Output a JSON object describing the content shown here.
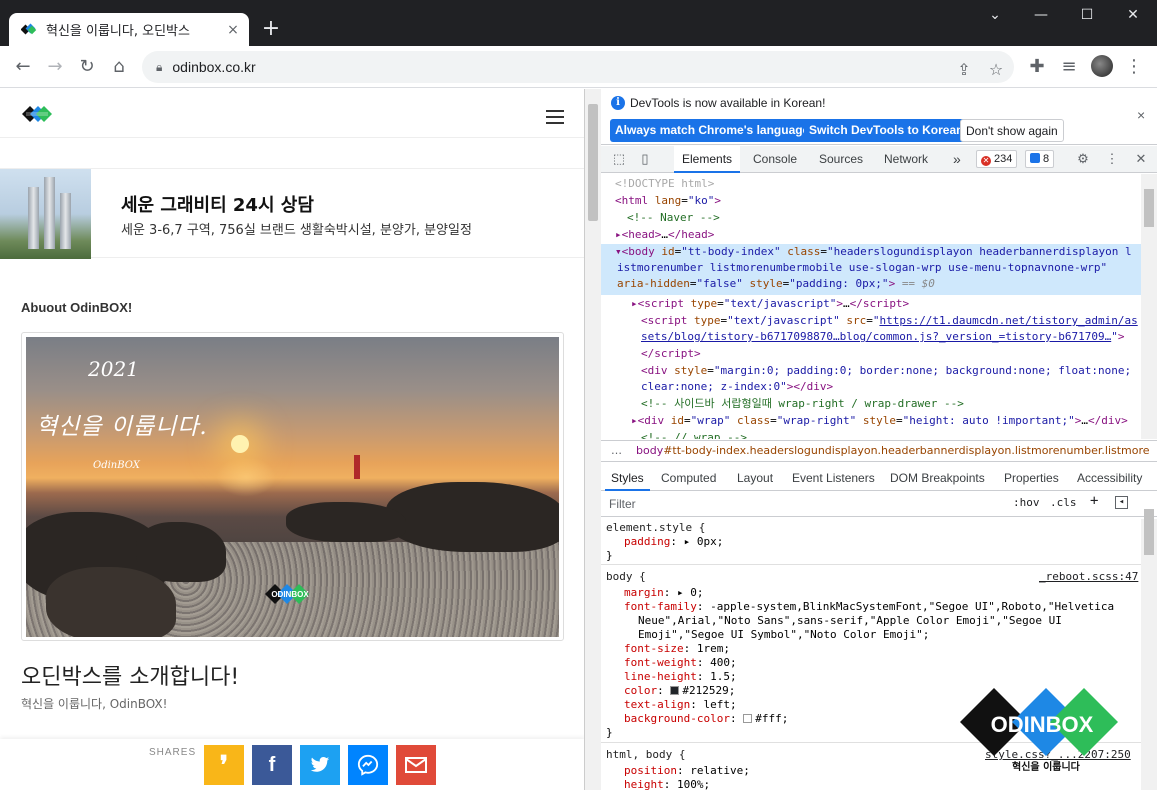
{
  "browser": {
    "tab_title": "혁신을 이룹니다, 오딘박스",
    "tab_close": "×",
    "new_tab": "+",
    "url": "odinbox.co.kr",
    "window_controls": [
      "⌄",
      "—",
      "☐",
      "✕"
    ]
  },
  "page": {
    "banner": {
      "title": "세운 그래비티 24시 상담",
      "subtitle": "세운 3-6,7 구역, 756실 브랜드 생활숙박시설, 분양가, 분양일정"
    },
    "about_label": "Abuout OdinBOX!",
    "hero": {
      "year": "2021",
      "script": "혁신을 이룹니다.",
      "brand": "OdinBOX"
    },
    "post_title": "오딘박스를 소개합니다!",
    "post_subtitle": "혁신을 이룹니다, OdinBOX!",
    "shares_label": "SHARES",
    "share_buttons": [
      {
        "name": "kakao",
        "color": "#f9b618",
        "glyph": "❜"
      },
      {
        "name": "facebook",
        "color": "#3b5998",
        "glyph": "f"
      },
      {
        "name": "twitter",
        "color": "#1da1f2",
        "glyph": "🐦"
      },
      {
        "name": "messenger",
        "color": "#0084ff",
        "glyph": "⚡"
      },
      {
        "name": "gmail",
        "color": "#e04a39",
        "glyph": "M"
      }
    ]
  },
  "devtools": {
    "info_text": "DevTools is now available in Korean!",
    "btn_match": "Always match Chrome's language",
    "btn_switch": "Switch DevTools to Korean",
    "btn_dont": "Don't show again",
    "close": "×",
    "tabs": [
      "Elements",
      "Console",
      "Sources",
      "Network"
    ],
    "more_tabs": "»",
    "error_count": "234",
    "message_count": "8",
    "dom_lines": [
      {
        "html": "<span class='t-gray'>&lt;!DOCTYPE html&gt;</span>"
      },
      {
        "html": "<span class='t-tag'>&lt;html</span> <span class='t-attr'>lang</span>=<span class='t-val'>\"ko\"</span><span class='t-tag'>&gt;</span>"
      },
      {
        "html": "&nbsp;&nbsp;<span class='t-com'>&lt;!-- Naver --&gt;</span>"
      },
      {
        "html": "<span class='t-tag'>▸&lt;head&gt;</span>…<span class='t-tag'>&lt;/head&gt;</span>"
      }
    ],
    "breadcrumb_more": "…",
    "breadcrumb_tag": "body",
    "breadcrumb_class": "#tt-body-index.headerslogundisplayon.headerbannerdisplayon.listmorenumber.listmore",
    "sub_tabs": [
      "Styles",
      "Computed",
      "Layout",
      "Event Listeners",
      "DOM Breakpoints",
      "Properties",
      "Accessibility"
    ],
    "filter_placeholder": "Filter",
    "filter_hov": ":hov",
    "filter_cls": ".cls",
    "styles": {
      "element_selector": "element.style {",
      "element_prop": "padding",
      "element_val": "0px;",
      "body_selector": "body {",
      "body_source": "_reboot.scss:47",
      "html_selector": "html, body {",
      "html_source": "style.css?_...2207:250",
      "close_brace": "}"
    }
  },
  "watermark": {
    "logo_text": "ODINBOX",
    "tagline": "혁신을 이룹니다"
  }
}
